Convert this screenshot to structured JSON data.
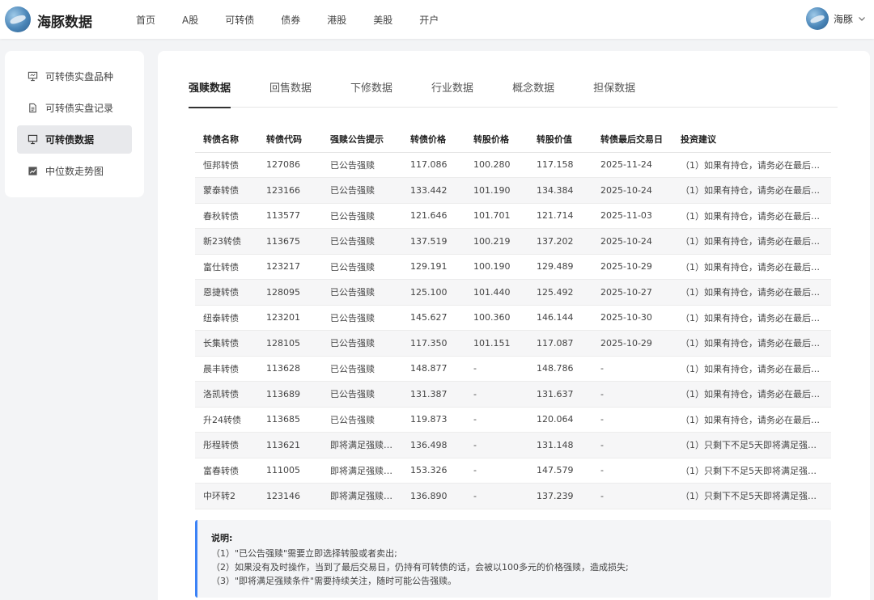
{
  "header": {
    "brand": "海豚数据",
    "nav": [
      "首页",
      "A股",
      "可转债",
      "债券",
      "港股",
      "美股",
      "开户"
    ],
    "user_name": "海豚"
  },
  "sidebar": {
    "items": [
      {
        "label": "可转债实盘品种",
        "icon": "presentation-icon",
        "active": false
      },
      {
        "label": "可转债实盘记录",
        "icon": "document-icon",
        "active": false
      },
      {
        "label": "可转债数据",
        "icon": "presentation-icon",
        "active": true
      },
      {
        "label": "中位数走势图",
        "icon": "line-chart-icon",
        "active": false
      }
    ]
  },
  "tabs": [
    {
      "label": "强赎数据",
      "active": true
    },
    {
      "label": "回售数据",
      "active": false
    },
    {
      "label": "下修数据",
      "active": false
    },
    {
      "label": "行业数据",
      "active": false
    },
    {
      "label": "概念数据",
      "active": false
    },
    {
      "label": "担保数据",
      "active": false
    }
  ],
  "table": {
    "columns": [
      "转债名称",
      "转债代码",
      "强赎公告提示",
      "转债价格",
      "转股价格",
      "转股价值",
      "转债最后交易日",
      "投资建议"
    ],
    "rows": [
      [
        "恒邦转债",
        "127086",
        "已公告强赎",
        "117.086",
        "100.280",
        "117.158",
        "2025-11-24",
        "（1）如果有持仓，请务必在最后…"
      ],
      [
        "蒙泰转债",
        "123166",
        "已公告强赎",
        "133.442",
        "101.190",
        "134.384",
        "2025-10-24",
        "（1）如果有持仓，请务必在最后…"
      ],
      [
        "春秋转债",
        "113577",
        "已公告强赎",
        "121.646",
        "101.701",
        "121.714",
        "2025-11-03",
        "（1）如果有持仓，请务必在最后…"
      ],
      [
        "新23转债",
        "113675",
        "已公告强赎",
        "137.519",
        "100.219",
        "137.202",
        "2025-10-24",
        "（1）如果有持仓，请务必在最后…"
      ],
      [
        "富仕转债",
        "123217",
        "已公告强赎",
        "129.191",
        "100.190",
        "129.489",
        "2025-10-29",
        "（1）如果有持仓，请务必在最后…"
      ],
      [
        "恩捷转债",
        "128095",
        "已公告强赎",
        "125.100",
        "101.440",
        "125.492",
        "2025-10-27",
        "（1）如果有持仓，请务必在最后…"
      ],
      [
        "纽泰转债",
        "123201",
        "已公告强赎",
        "145.627",
        "100.360",
        "146.144",
        "2025-10-30",
        "（1）如果有持仓，请务必在最后…"
      ],
      [
        "长集转债",
        "128105",
        "已公告强赎",
        "117.350",
        "101.151",
        "117.087",
        "2025-10-29",
        "（1）如果有持仓，请务必在最后…"
      ],
      [
        "晨丰转债",
        "113628",
        "已公告强赎",
        "148.877",
        "-",
        "148.786",
        "-",
        "（1）如果有持仓，请务必在最后…"
      ],
      [
        "洛凯转债",
        "113689",
        "已公告强赎",
        "131.387",
        "-",
        "131.637",
        "-",
        "（1）如果有持仓，请务必在最后…"
      ],
      [
        "升24转债",
        "113685",
        "已公告强赎",
        "119.873",
        "-",
        "120.064",
        "-",
        "（1）如果有持仓，请务必在最后…"
      ],
      [
        "彤程转债",
        "113621",
        "即将满足强赎…",
        "136.498",
        "-",
        "131.148",
        "-",
        "（1）只剩下不足5天即将满足强…"
      ],
      [
        "富春转债",
        "111005",
        "即将满足强赎…",
        "153.326",
        "-",
        "147.579",
        "-",
        "（1）只剩下不足5天即将满足强…"
      ],
      [
        "中环转2",
        "123146",
        "即将满足强赎…",
        "136.890",
        "-",
        "137.239",
        "-",
        "（1）只剩下不足5天即将满足强…"
      ]
    ]
  },
  "note": {
    "title": "说明:",
    "lines": [
      "（1）\"已公告强赎\"需要立即选择转股或者卖出;",
      "（2）如果没有及时操作，当到了最后交易日，仍持有可转债的话，会被以100多元的价格强赎，造成损失;",
      "（3）\"即将满足强赎条件\"需要持续关注，随时可能公告强赎。"
    ]
  },
  "colors": {
    "accent": "#3b82f6",
    "background": "#f3f4f6",
    "active_item_bg": "#e8e9ec"
  }
}
